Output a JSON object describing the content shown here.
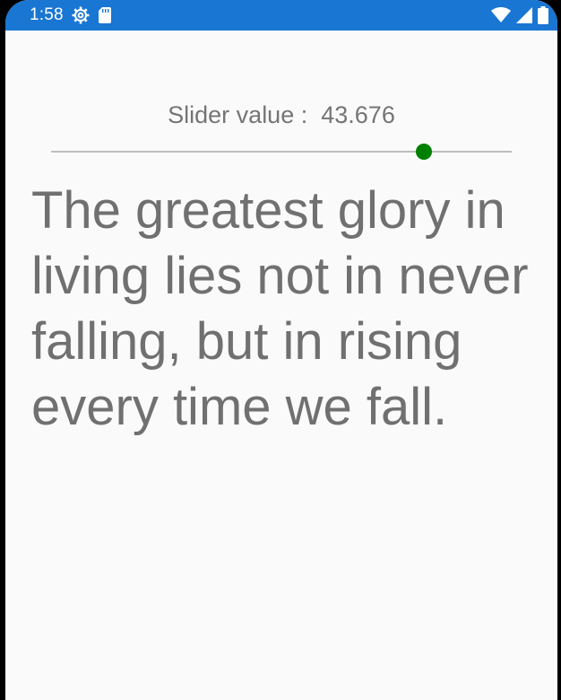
{
  "status_bar": {
    "time": "1:58",
    "left_icons": [
      "settings-gear-icon",
      "sd-card-icon"
    ],
    "right_icons": [
      "wifi-icon",
      "cell-signal-icon",
      "battery-icon"
    ],
    "background_color": "#1976d2"
  },
  "slider": {
    "label_prefix": "Slider value :",
    "value_text": "43.676",
    "fraction": 0.81,
    "thumb_color": "#008000",
    "track_color": "#bdbdbd"
  },
  "quote": {
    "text": "The greatest glory in living lies not in never falling, but in rising every time we fall."
  }
}
